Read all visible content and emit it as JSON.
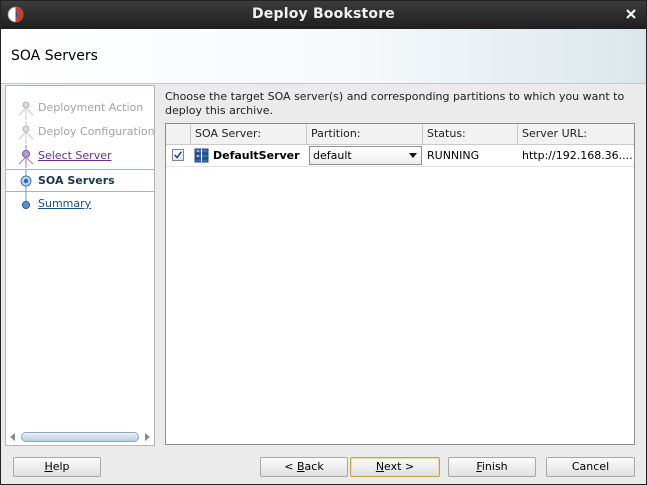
{
  "window": {
    "title": "Deploy Bookstore",
    "accent_color": "#cc3b22"
  },
  "header": {
    "page_title": "SOA Servers"
  },
  "train": {
    "steps": [
      {
        "label": "Deployment Action",
        "state": "disabled"
      },
      {
        "label": "Deploy Configuration",
        "state": "disabled"
      },
      {
        "label": "Select Server",
        "state": "visited"
      },
      {
        "label": "SOA Servers",
        "state": "active"
      },
      {
        "label": "Summary",
        "state": "link"
      }
    ]
  },
  "content": {
    "instructions": "Choose the target SOA server(s) and corresponding partitions to which you want to deploy this archive.",
    "table": {
      "columns": [
        "SOA Server:",
        "Partition:",
        "Status:",
        "Server URL:"
      ],
      "rows": [
        {
          "checked": true,
          "server": "DefaultServer",
          "partition": "default",
          "status": "RUNNING",
          "url": "http://192.168.36...."
        }
      ]
    }
  },
  "buttons": {
    "help": {
      "mnemonic": "H",
      "rest": "elp"
    },
    "back": {
      "prefix": "< ",
      "mnemonic": "B",
      "rest": "ack"
    },
    "next": {
      "mnemonic": "N",
      "rest": "ext >"
    },
    "finish": {
      "mnemonic": "F",
      "rest": "inish"
    },
    "cancel": "Cancel"
  }
}
